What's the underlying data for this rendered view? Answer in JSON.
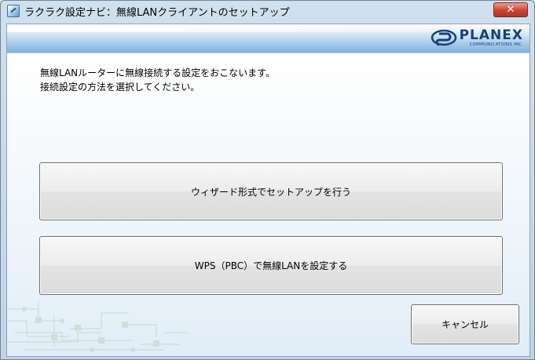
{
  "window": {
    "title": "ラクラク設定ナビ：無線LANクライアントのセットアップ",
    "close_glyph": "✕"
  },
  "brand": {
    "name": "PLANEX",
    "tagline": "COMMUNICATIONS INC."
  },
  "message": {
    "line1": "無線LANルーターに無線接続する設定をおこないます。",
    "line2": "接続設定の方法を選択してください。"
  },
  "options": {
    "wizard_label": "ウィザード形式でセットアップを行う",
    "wps_label": "WPS（PBC）で無線LANを設定する"
  },
  "footer": {
    "cancel_label": "キャンセル"
  },
  "colors": {
    "brand_blue": "#1b3f78",
    "close_red": "#c8452f",
    "banner_blue": "#7db0dd"
  }
}
